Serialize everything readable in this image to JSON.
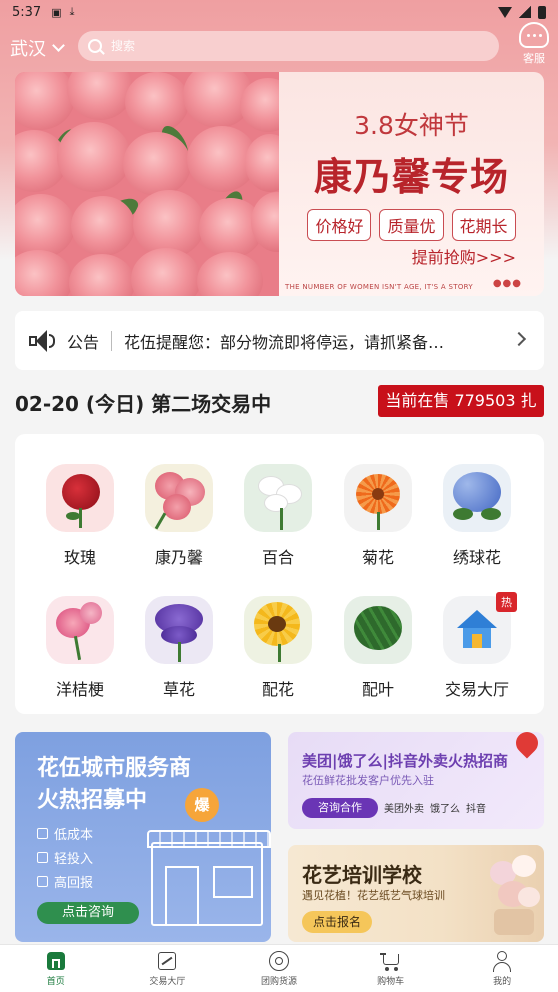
{
  "status_bar": {
    "time": "5:37"
  },
  "header": {
    "city": "武汉",
    "search_placeholder": "搜索",
    "service_label": "客服"
  },
  "banner": {
    "line1": "3.8女神节",
    "line2": "康乃馨专场",
    "tags": [
      "价格好",
      "质量优",
      "花期长"
    ],
    "cta": "提前抢购>>>",
    "small_text": "THE NUMBER OF WOMEN ISN'T AGE, IT'S A STORY"
  },
  "notice": {
    "label": "公告",
    "text": "花伍提醒您：部分物流即将停运，请抓紧备…"
  },
  "session": {
    "title": "02-20 (今日) 第二场交易中",
    "on_sale": "当前在售 779503 扎"
  },
  "categories": [
    {
      "label": "玫瑰",
      "icon": "rose-icon"
    },
    {
      "label": "康乃馨",
      "icon": "carnation-icon"
    },
    {
      "label": "百合",
      "icon": "lily-icon"
    },
    {
      "label": "菊花",
      "icon": "chrysanthemum-icon"
    },
    {
      "label": "绣球花",
      "icon": "hydrangea-icon"
    },
    {
      "label": "洋桔梗",
      "icon": "eustoma-icon"
    },
    {
      "label": "草花",
      "icon": "statice-icon"
    },
    {
      "label": "配花",
      "icon": "sunflower-icon"
    },
    {
      "label": "配叶",
      "icon": "monstera-leaf-icon"
    },
    {
      "label": "交易大厅",
      "icon": "house-icon",
      "badge": "热"
    }
  ],
  "recruit_card": {
    "line1": "花伍城市服务商",
    "line2": "火热招募中",
    "badge": "爆",
    "features": [
      "低成本",
      "轻投入",
      "高回报"
    ],
    "button": "点击咨询"
  },
  "meituan_card": {
    "title": "美团|饿了么|抖音外卖火热招商",
    "subtitle": "花伍鲜花批发客户优先入驻",
    "button": "咨询合作",
    "brands": [
      "美团外卖",
      "饿了么",
      "抖音"
    ]
  },
  "training_card": {
    "title": "花艺培训学校",
    "subtitle": "遇见花植！花艺纸艺气球培训",
    "button": "点击报名"
  },
  "tabbar": [
    {
      "label": "首页",
      "icon": "home-icon",
      "active": true
    },
    {
      "label": "交易大厅",
      "icon": "chart-icon",
      "active": false
    },
    {
      "label": "团购货源",
      "icon": "groupbuy-icon",
      "active": false
    },
    {
      "label": "购物车",
      "icon": "cart-icon",
      "active": false
    },
    {
      "label": "我的",
      "icon": "user-icon",
      "active": false
    }
  ],
  "colors": {
    "accent_red": "#c8101a",
    "active_green": "#1a7a3c",
    "banner_red": "#b8242b"
  }
}
